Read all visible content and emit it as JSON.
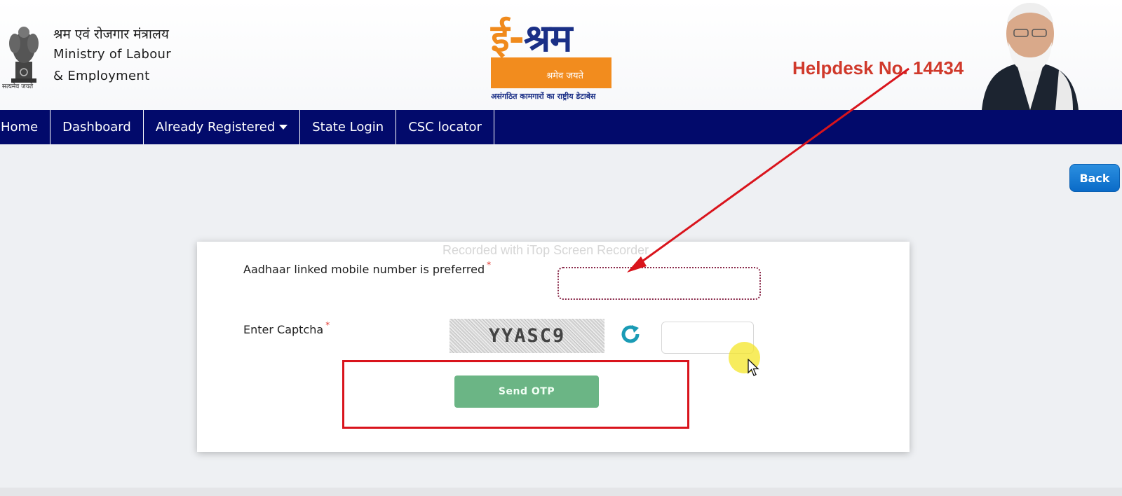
{
  "header": {
    "emblem_motto": "सत्यमेव जयते",
    "ministry_hindi": "श्रम एवं रोजगार मंत्रालय",
    "ministry_line1": "Ministry of Labour",
    "ministry_line2": "& Employment",
    "logo_title_orange": "ई-",
    "logo_title_blue": "श्रम",
    "logo_motto": "श्रमेव जयते",
    "logo_subtitle": "असंगठित कामगारों का राष्ट्रीय डेटाबेस",
    "helpdesk": "Helpdesk No. 14434"
  },
  "nav": {
    "items": [
      "Home",
      "Dashboard",
      "Already Registered",
      "State Login",
      "CSC locator"
    ]
  },
  "back_label": "Back",
  "form": {
    "watermark": "Recorded with iTop Screen Recorder",
    "mobile_label": "Aadhaar linked mobile number is preferred",
    "captcha_label": "Enter Captcha",
    "required_mark": "*",
    "captcha_text": "YYASC9",
    "mobile_value": "",
    "captcha_value": "",
    "send_otp_label": "Send OTP"
  },
  "colors": {
    "nav_bg": "#020a6b",
    "helpdesk": "#d0392b",
    "send_otp_bg": "#6bb585",
    "highlight_box": "#d9141c",
    "back_button": "#0a6bc8"
  }
}
